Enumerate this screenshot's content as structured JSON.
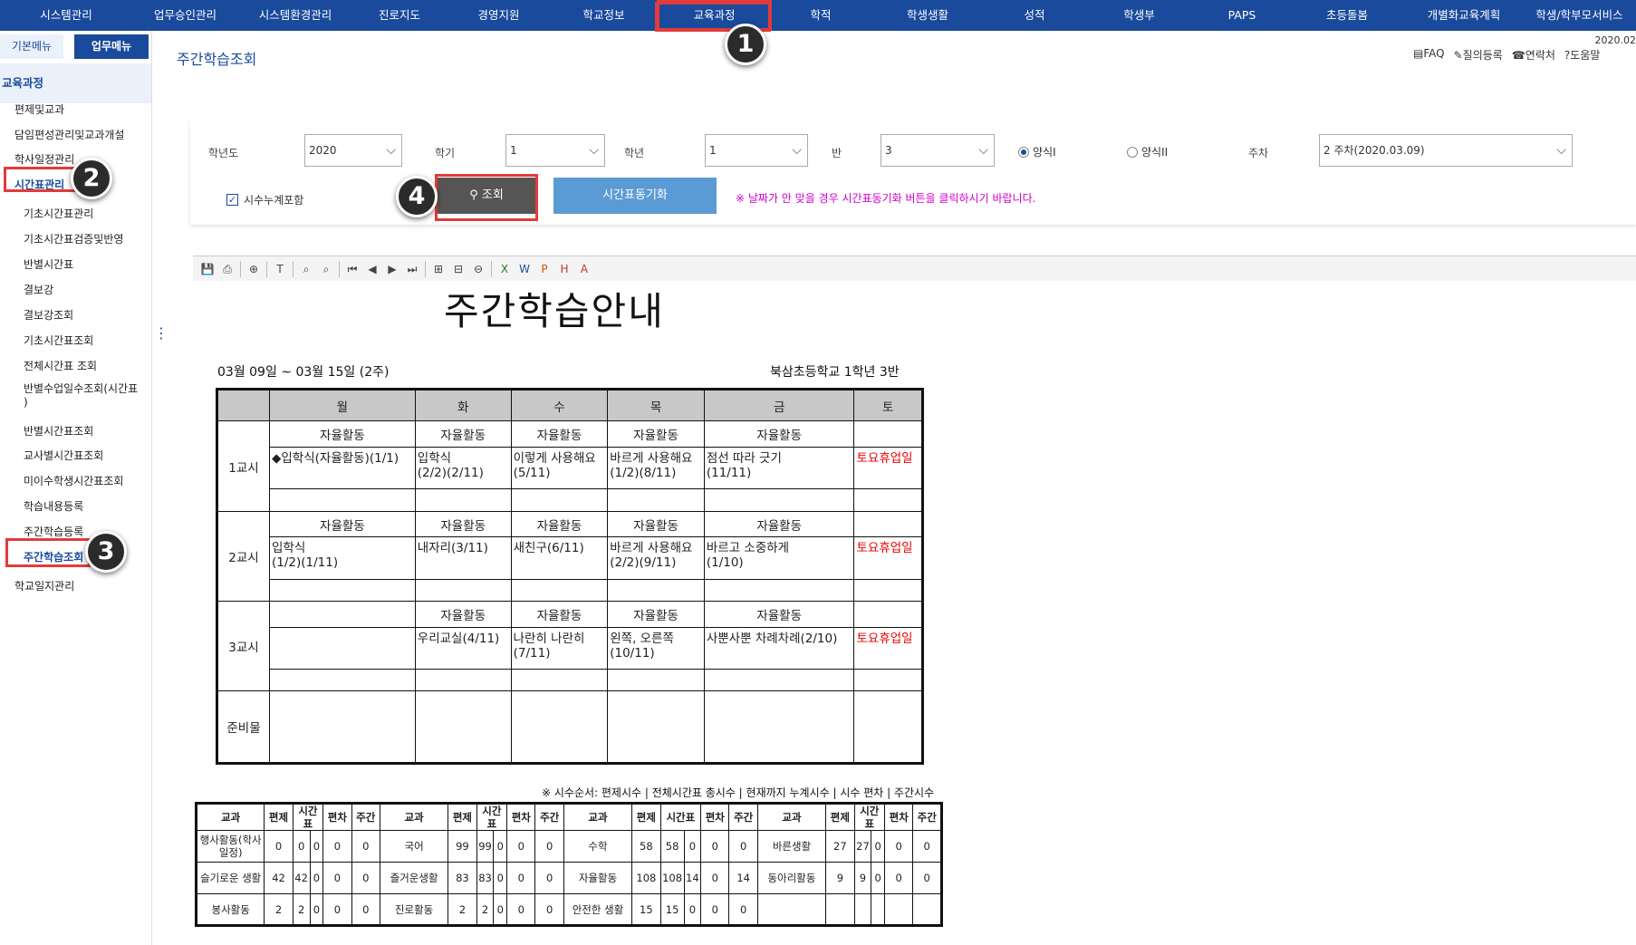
{
  "topnav": {
    "items": [
      "시스템관리",
      "업무승인관리",
      "시스템환경관리",
      "진로지도",
      "경영지원",
      "학교정보",
      "교육과정",
      "학적",
      "학생생활",
      "성적",
      "학생부",
      "PAPS",
      "초등돌봄",
      "개별화교육계획",
      "학생/학부모서비스"
    ],
    "active_index": 6
  },
  "badges": [
    "1",
    "2",
    "3",
    "4"
  ],
  "sidebar": {
    "tab_basic": "기본메뉴",
    "tab_work": "업무메뉴",
    "section_title": "교육과정",
    "items": [
      "편제및교과",
      "담임편성관리및교과개설",
      "학사일정관리",
      "시간표관리",
      "기초시간표관리",
      "기초시간표검증및반영",
      "반별시간표",
      "결보강",
      "결보강조회",
      "기초시간표조회",
      "전체시간표 조회",
      "반별수업일수조회(시간표\n)",
      "반별시간표조회",
      "교사별시간표조회",
      "미이수학생시간표조회",
      "학습내용등록",
      "주간학습등록",
      "주간학습조회",
      "학교일지관리"
    ],
    "selected_index": 17
  },
  "page": {
    "title": "주간학습조회",
    "date": "2020.02",
    "links": [
      "FAQ",
      "질의등록",
      "연락처",
      "도움말"
    ]
  },
  "filter": {
    "year_label": "학년도",
    "year_value": "2020",
    "term_label": "학기",
    "term_value": "1",
    "grade_label": "학년",
    "grade_value": "1",
    "class_label": "반",
    "class_value": "3",
    "radio_1": "양식I",
    "radio_2": "양식II",
    "radio_selected": 1,
    "week_label": "주차",
    "week_value": "2 주차(2020.03.09)",
    "checkbox_label": "시수누계포함",
    "checkbox_checked": true,
    "search_button": "조회",
    "sync_button": "시간표동기화",
    "warning": "※ 날짜가 안 맞을 경우 시간표동기화 버튼을 클릭하시기 바랍니다."
  },
  "report": {
    "title": "주간학습안내",
    "date_range": "03월 09일 ~ 03월 15일 (2주)",
    "school": "북삼초등학교 1학년 3반",
    "days": [
      "월",
      "화",
      "수",
      "목",
      "금",
      "토"
    ],
    "periods": [
      {
        "label": "1교시",
        "activity": [
          "자율활동",
          "자율활동",
          "자율활동",
          "자율활동",
          "자율활동",
          ""
        ],
        "content": [
          "◆입학식(자율활동)(1/1)",
          "입학식\n(2/2)(2/11)",
          "이렇게 사용해요\n(5/11)",
          "바르게 사용해요\n(1/2)(8/11)",
          "점선 따라 긋기\n(11/11)",
          "토요휴업일"
        ]
      },
      {
        "label": "2교시",
        "activity": [
          "자율활동",
          "자율활동",
          "자율활동",
          "자율활동",
          "자율활동",
          ""
        ],
        "content": [
          "입학식\n(1/2)(1/11)",
          "내자리(3/11)",
          "새친구(6/11)",
          "바르게 사용해요\n(2/2)(9/11)",
          "바르고 소중하게\n(1/10)",
          "토요휴업일"
        ]
      },
      {
        "label": "3교시",
        "activity": [
          "",
          "자율활동",
          "자율활동",
          "자율활동",
          "자율활동",
          ""
        ],
        "content": [
          "",
          "우리교실(4/11)",
          "나란히 나란히\n(7/11)",
          "왼쪽, 오른쪽\n(10/11)",
          "사뿐사뿐 차례차례(2/10)",
          "토요휴업일"
        ]
      }
    ],
    "prep_label": "준비물",
    "count_note": "※ 시수순서: 편제시수 | 전체시간표 총시수 | 현재까지 누계시수 | 시수 편차 | 주간시수",
    "count_headers": [
      "교과",
      "편제",
      "시간표",
      "편차",
      "주간"
    ],
    "count_rows": [
      [
        [
          "행사활동(학사일정)",
          "0",
          "0",
          "0",
          "0",
          "0"
        ],
        [
          "국어",
          "99",
          "99",
          "0",
          "0",
          "0"
        ],
        [
          "수학",
          "58",
          "58",
          "0",
          "0",
          "0"
        ],
        [
          "바른생활",
          "27",
          "27",
          "0",
          "0",
          "0"
        ]
      ],
      [
        [
          "슬기로운 생활",
          "42",
          "42",
          "0",
          "0",
          "0"
        ],
        [
          "즐거운생활",
          "83",
          "83",
          "0",
          "0",
          "0"
        ],
        [
          "자율활동",
          "108",
          "108",
          "14",
          "0",
          "14"
        ],
        [
          "동아리활동",
          "9",
          "9",
          "0",
          "0",
          "0"
        ]
      ],
      [
        [
          "봉사활동",
          "2",
          "2",
          "0",
          "0",
          "0"
        ],
        [
          "진로활동",
          "2",
          "2",
          "0",
          "0",
          "0"
        ],
        [
          "안전한 생활",
          "15",
          "15",
          "0",
          "0",
          "0"
        ],
        [
          "",
          "",
          "",
          "",
          "",
          ""
        ]
      ]
    ]
  },
  "colors": {
    "nav": "#1a4a9c",
    "highlight": "#e23b3b",
    "sync_button": "#5b9bd5",
    "search_button": "#555555",
    "warning": "#d000d0",
    "holiday": "#e00000"
  }
}
